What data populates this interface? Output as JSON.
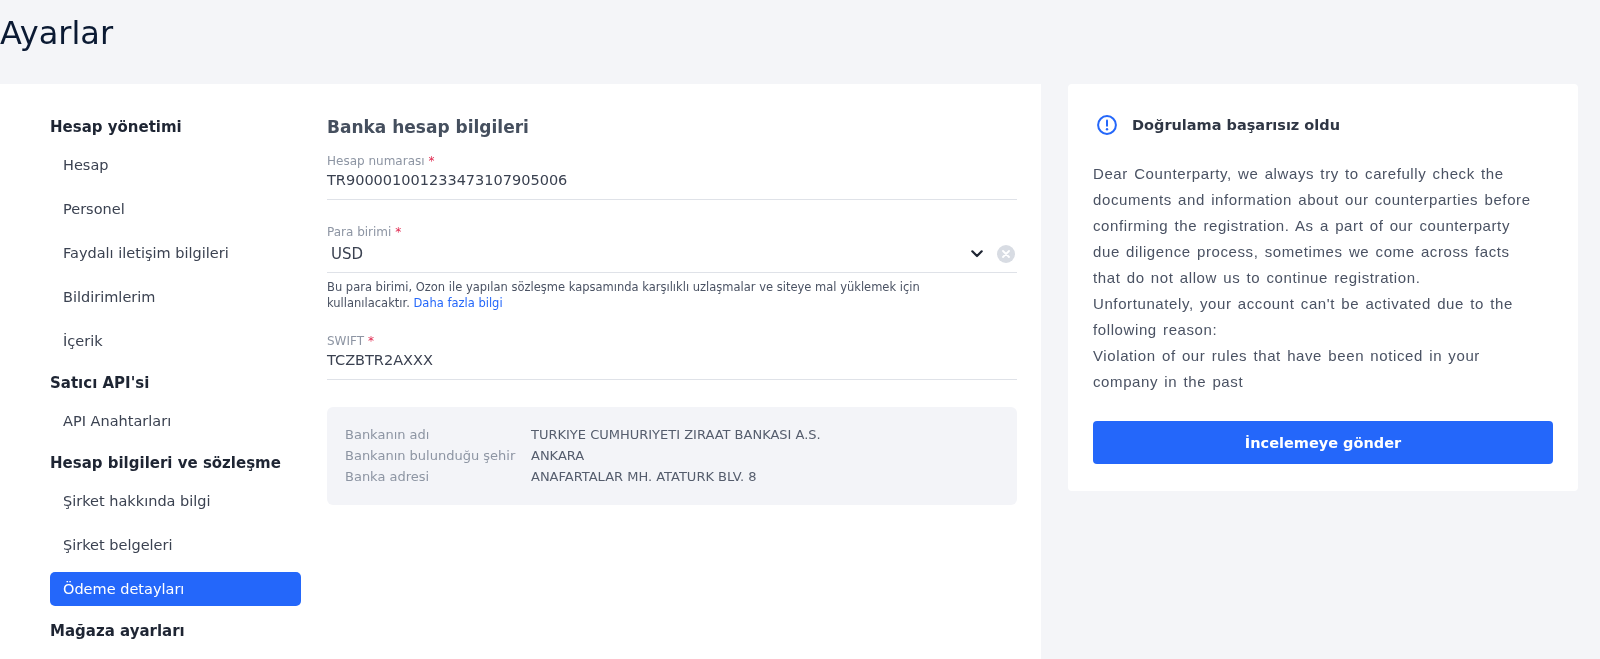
{
  "page": {
    "title": "Ayarlar"
  },
  "sidebar": {
    "groups": [
      {
        "heading": "Hesap yönetimi",
        "items": [
          {
            "label": "Hesap",
            "selected": false
          },
          {
            "label": "Personel",
            "selected": false
          },
          {
            "label": "Faydalı iletişim bilgileri",
            "selected": false
          },
          {
            "label": "Bildirimlerim",
            "selected": false
          },
          {
            "label": "İçerik",
            "selected": false
          }
        ]
      },
      {
        "heading": "Satıcı API'si",
        "items": [
          {
            "label": "API Anahtarları",
            "selected": false
          }
        ]
      },
      {
        "heading": "Hesap bilgileri ve sözleşme",
        "items": [
          {
            "label": "Şirket hakkında bilgi",
            "selected": false
          },
          {
            "label": "Şirket belgeleri",
            "selected": false
          },
          {
            "label": "Ödeme detayları",
            "selected": true
          }
        ]
      },
      {
        "heading": "Mağaza ayarları"
      }
    ]
  },
  "form": {
    "title": "Banka hesap bilgileri",
    "fields": [
      {
        "kind": "text",
        "label": "Hesap numarası",
        "required_mark": "*",
        "value": "TR900001001233473107905006"
      },
      {
        "kind": "select",
        "label": "Para birimi",
        "required_mark": "*",
        "value": "USD",
        "help": {
          "text": "Bu para birimi, Ozon ile yapılan sözleşme kapsamında karşılıklı uzlaşmalar ve siteye mal yüklemek için kullanılacaktır.",
          "link": "Daha fazla bilgi"
        }
      },
      {
        "kind": "text",
        "label": "SWIFT",
        "required_mark": "*",
        "value": "TCZBTR2AXXX"
      }
    ],
    "bank_info": [
      {
        "label": "Bankanın adı",
        "value": "TURKIYE CUMHURIYETI ZIRAAT BANKASI A.S."
      },
      {
        "label": "Bankanın bulunduğu şehir",
        "value": "ANKARA"
      },
      {
        "label": "Banka adresi",
        "value": "ANAFARTALAR MH. ATATURK BLV. 8"
      }
    ]
  },
  "notice": {
    "title": "Doğrulama başarısız oldu",
    "paragraphs": [
      "Dear Counterparty, we always try to carefully check the documents and information about our counterparties before confirming the registration. As a part of our counterparty due diligence process, sometimes we come across facts that do not allow us to continue registration.",
      "Unfortunately, your account can't be activated due to the following reason:",
      "Violation of our rules that have been noticed in your company in the past"
    ],
    "button": "İncelemeye gönder"
  }
}
